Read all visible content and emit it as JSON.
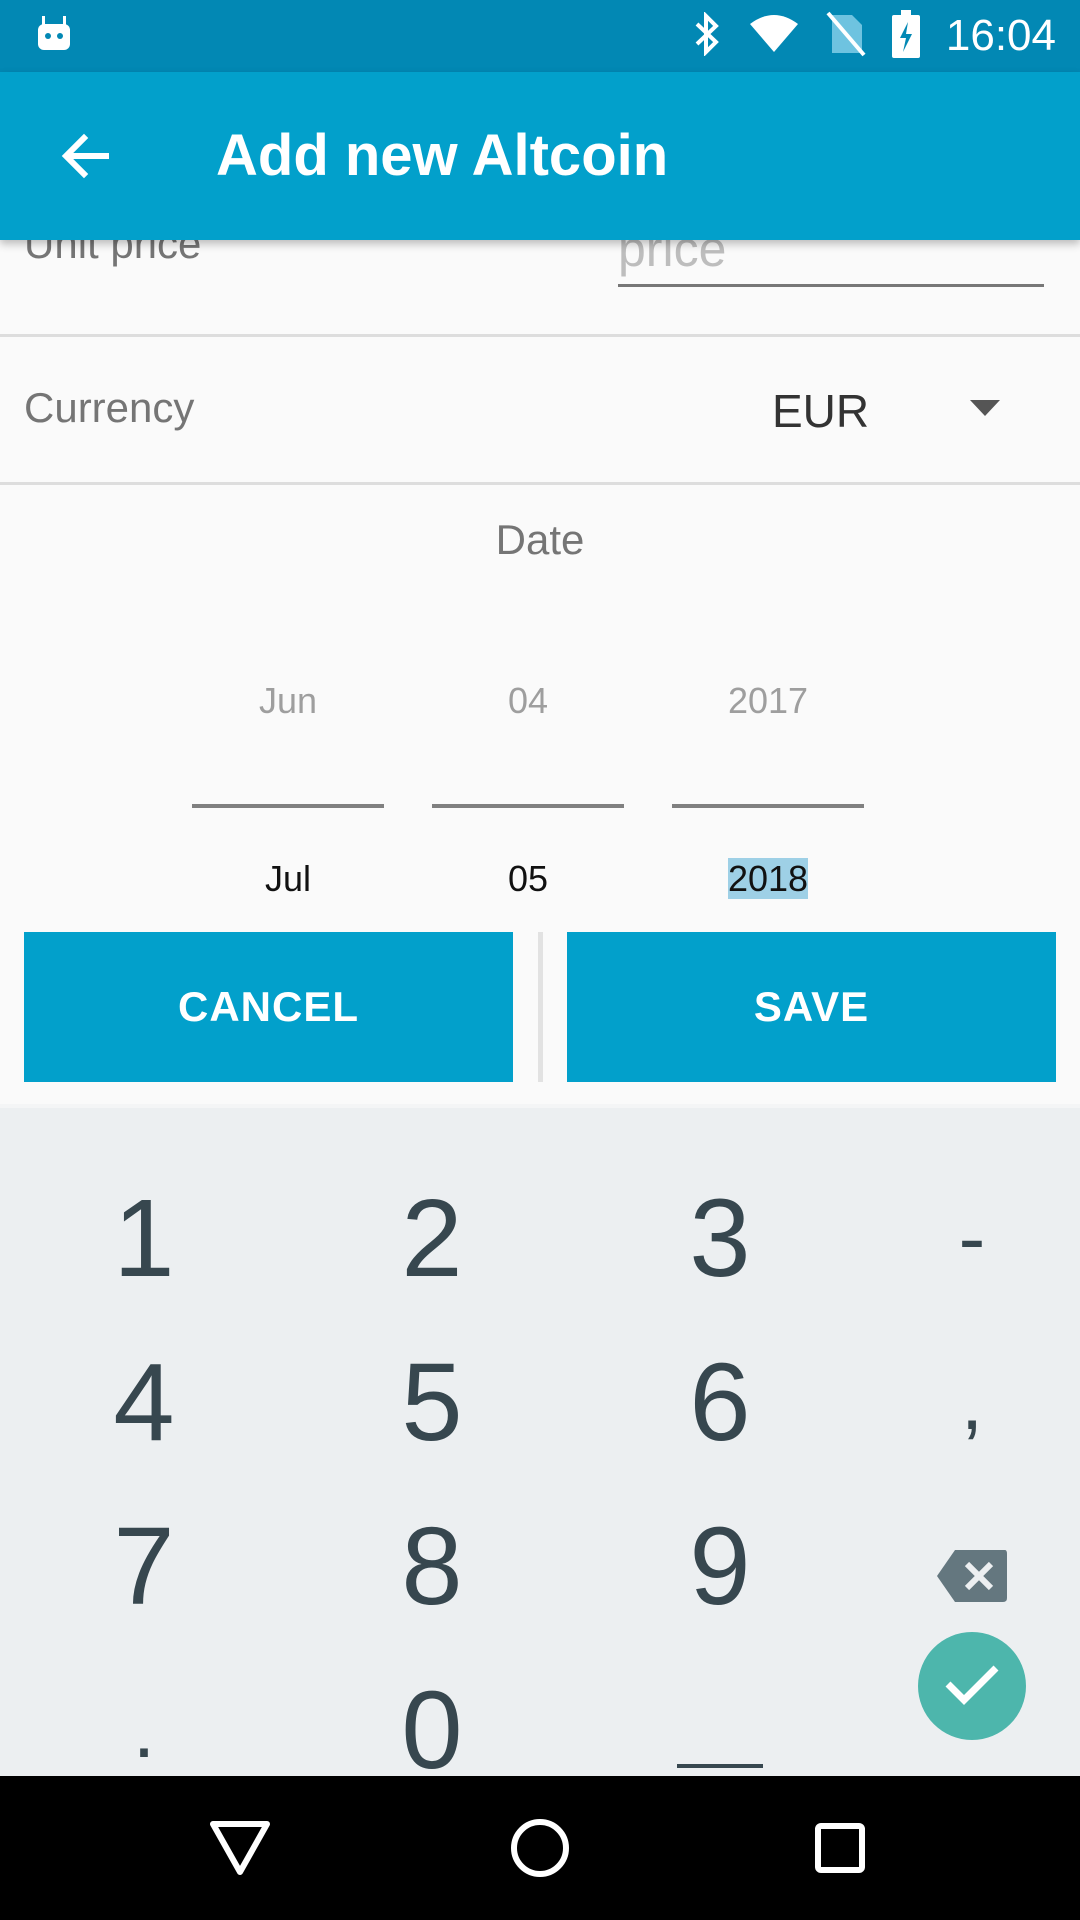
{
  "status_bar": {
    "time": "16:04",
    "icons": [
      "android-icon",
      "bluetooth-icon",
      "wifi-icon",
      "no-sim-icon",
      "battery-charging-icon"
    ]
  },
  "app_bar": {
    "title": "Add new Altcoin",
    "back_icon": "arrow-back-icon"
  },
  "form": {
    "unit_price_label": "Unit price",
    "price_placeholder": "price",
    "price_value": "",
    "currency_label": "Currency",
    "currency_value": "EUR",
    "date_label": "Date"
  },
  "date_picker": {
    "month": {
      "prev": "Jun",
      "current": "Jul"
    },
    "day": {
      "prev": "04",
      "current": "05"
    },
    "year": {
      "prev": "2017",
      "current": "2018"
    }
  },
  "buttons": {
    "cancel": "CANCEL",
    "save": "SAVE"
  },
  "keypad": {
    "keys": [
      "1",
      "2",
      "3",
      "-",
      "4",
      "5",
      "6",
      ",",
      "7",
      "8",
      "9",
      "backspace",
      ".",
      "0",
      "_",
      "done"
    ]
  },
  "colors": {
    "status_bar": "#0288B4",
    "primary": "#02A0CB",
    "keypad_bg": "#ECEFF1",
    "keypad_text": "#37474F",
    "done_button": "#4DB6AC",
    "selection_highlight": "#9ED0E6"
  },
  "nav_bar": {
    "icons": [
      "back-triangle-icon",
      "home-circle-icon",
      "recents-square-icon"
    ]
  }
}
